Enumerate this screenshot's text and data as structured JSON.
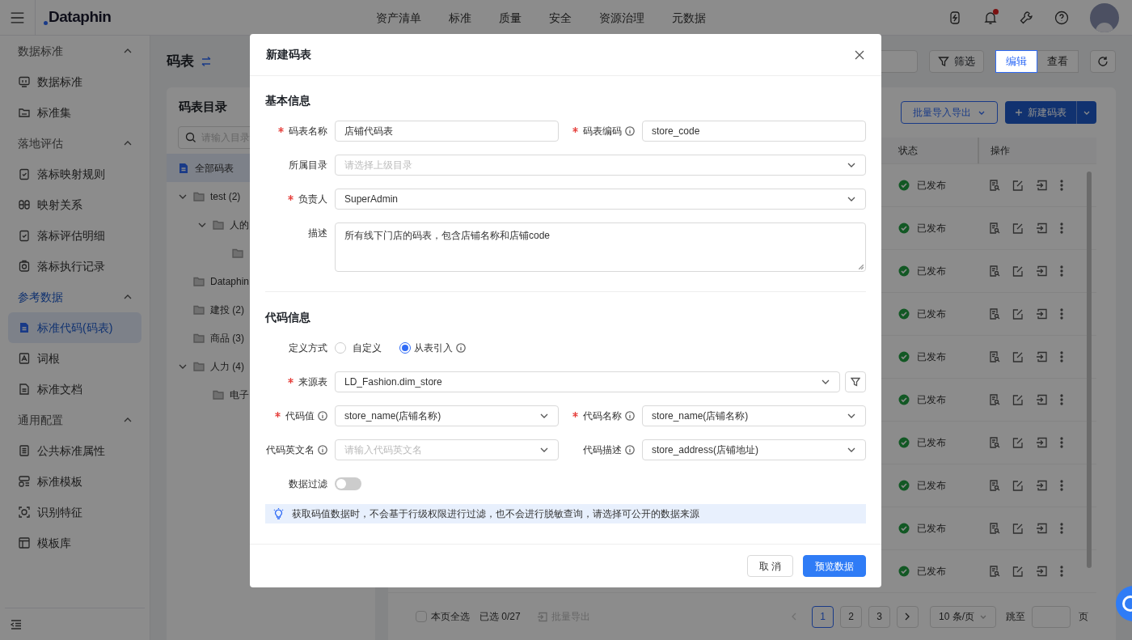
{
  "top_nav": {
    "logo": "Dataphin",
    "menu": [
      "资产清单",
      "标准",
      "质量",
      "安全",
      "资源治理",
      "元数据"
    ],
    "notification_badge": true
  },
  "sidebar": {
    "groups": [
      {
        "title": "数据标准",
        "expanded": true,
        "active": false,
        "items": [
          {
            "label": "数据标准",
            "selected": false
          },
          {
            "label": "标准集",
            "selected": false
          }
        ]
      },
      {
        "title": "落地评估",
        "expanded": true,
        "active": false,
        "items": [
          {
            "label": "落标映射规则",
            "selected": false
          },
          {
            "label": "映射关系",
            "selected": false
          },
          {
            "label": "落标评估明细",
            "selected": false
          },
          {
            "label": "落标执行记录",
            "selected": false
          }
        ]
      },
      {
        "title": "参考数据",
        "expanded": true,
        "active": true,
        "items": [
          {
            "label": "标准代码(码表)",
            "selected": true
          },
          {
            "label": "词根",
            "selected": false
          },
          {
            "label": "标准文档",
            "selected": false
          }
        ]
      },
      {
        "title": "通用配置",
        "expanded": true,
        "active": false,
        "items": [
          {
            "label": "公共标准属性",
            "selected": false
          },
          {
            "label": "标准模板",
            "selected": false
          },
          {
            "label": "识别特征",
            "selected": false
          },
          {
            "label": "模板库",
            "selected": false
          }
        ]
      }
    ]
  },
  "page": {
    "title": "码表"
  },
  "toolbar": {
    "filter_button": "筛选",
    "view_modes": [
      {
        "label": "编辑",
        "selected": true
      },
      {
        "label": "查看",
        "selected": false
      }
    ]
  },
  "catalog": {
    "title": "码表目录",
    "search_placeholder": "请输入目录",
    "tree": [
      {
        "label": "全部码表",
        "selected": true,
        "kind": "all"
      },
      {
        "label": "test (2)",
        "selected": false,
        "expanded": true,
        "children": [
          {
            "label": "人的",
            "selected": false,
            "expanded": true,
            "children": [
              {
                "selected": false
              }
            ]
          }
        ]
      },
      {
        "label": "Dataphin",
        "selected": false
      },
      {
        "label": "建投 (2)",
        "selected": false
      },
      {
        "label": "商品 (3)",
        "selected": false
      },
      {
        "label": "人力 (4)",
        "selected": false,
        "expanded": true,
        "children": [
          {
            "label": "电子",
            "selected": false
          }
        ]
      }
    ]
  },
  "list_actions": {
    "import_export": "批量导入导出",
    "create": "新建码表"
  },
  "table": {
    "columns": [
      "状态",
      "操作"
    ],
    "rows": [
      {
        "status": "已发布"
      },
      {
        "status": "已发布"
      },
      {
        "status": "已发布"
      },
      {
        "status": "已发布"
      },
      {
        "status": "已发布"
      },
      {
        "status": "已发布"
      },
      {
        "status": "已发布"
      },
      {
        "status": "已发布"
      },
      {
        "status": "已发布"
      },
      {
        "status": "已发布"
      }
    ]
  },
  "table_footer": {
    "select_all": {
      "label": "本页全选",
      "checked": false
    },
    "selected_count": "已选 0/27",
    "export": {
      "label": "批量导出",
      "disabled": true
    },
    "pages": [
      {
        "label": "1",
        "selected": true
      },
      {
        "label": "2",
        "selected": false
      },
      {
        "label": "3",
        "selected": false
      }
    ],
    "page_size": "10 条/页",
    "jump_label": "跳至",
    "page_unit": "页"
  },
  "modal": {
    "title": "新建码表",
    "sections": [
      {
        "title": "基本信息",
        "rows": [
          [
            {
              "label": "码表名称",
              "required": true,
              "info": false,
              "kind": "text",
              "value": "店铺代码表"
            },
            {
              "label": "码表编码",
              "required": true,
              "info": true,
              "kind": "text",
              "value": "store_code"
            }
          ],
          [
            {
              "label": "所属目录",
              "required": false,
              "info": false,
              "kind": "select",
              "placeholder": "请选择上级目录"
            }
          ],
          [
            {
              "label": "负责人",
              "required": true,
              "info": false,
              "kind": "select",
              "value": "SuperAdmin"
            }
          ],
          [
            {
              "label": "描述",
              "required": false,
              "info": false,
              "kind": "textarea",
              "value": "所有线下门店的码表，包含店铺名称和店铺code"
            }
          ]
        ]
      },
      {
        "title": "代码信息",
        "rows": [
          [
            {
              "label": "定义方式",
              "required": false,
              "info": false,
              "kind": "radio",
              "options": [
                {
                  "label": "自定义",
                  "selected": false,
                  "info": false
                },
                {
                  "label": "从表引入",
                  "selected": true,
                  "info": true
                }
              ]
            }
          ],
          [
            {
              "label": "来源表",
              "required": true,
              "info": false,
              "kind": "select_filter",
              "value": "LD_Fashion.dim_store"
            }
          ],
          [
            {
              "label": "代码值",
              "required": true,
              "info": true,
              "kind": "select",
              "value": "store_name(店铺名称)"
            },
            {
              "label": "代码名称",
              "required": true,
              "info": true,
              "kind": "select",
              "value": "store_name(店铺名称)"
            }
          ],
          [
            {
              "label": "代码英文名",
              "required": false,
              "info": true,
              "kind": "select",
              "placeholder": "请输入代码英文名"
            },
            {
              "label": "代码描述",
              "required": false,
              "info": true,
              "kind": "select",
              "value": "store_address(店铺地址)"
            }
          ],
          [
            {
              "label": "数据过滤",
              "required": false,
              "info": false,
              "kind": "toggle",
              "on": false
            }
          ]
        ],
        "alert": "获取码值数据时，不会基于行级权限进行过滤，也不会进行脱敏查询，请选择可公开的数据来源"
      }
    ],
    "buttons": [
      {
        "label": "取 消",
        "kind": "default"
      },
      {
        "label": "预览数据",
        "kind": "primary"
      }
    ]
  }
}
